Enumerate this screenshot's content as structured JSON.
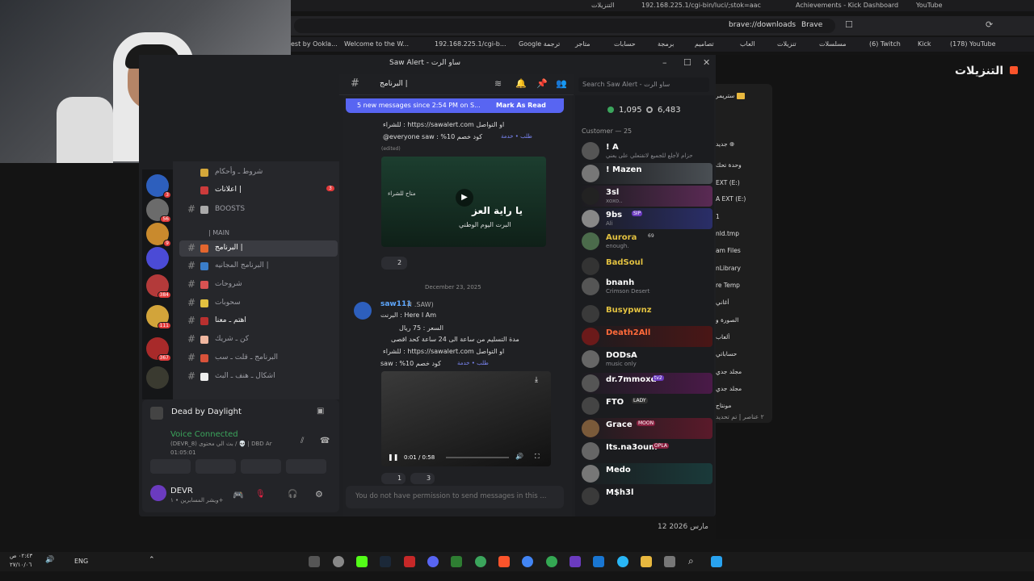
{
  "browser": {
    "tabs": [
      "التنزيلات",
      "192.168.225.1/cgi-bin/luci/;stok=aac",
      "Achievements - Kick Dashboard",
      "YouTube"
    ],
    "url": "brave://downloads",
    "brand": "Brave",
    "bookmarks": [
      "est by Ookla...",
      "Welcome to the W...",
      "192.168.225.1/cgi-b...",
      "Google ترجمة",
      "متاجر",
      "حسابات",
      "برمجة",
      "تصاميم",
      "العاب",
      "تنزيلات",
      "مسلسلات",
      "(6) Twitch",
      "Kick",
      "(178) YouTube"
    ],
    "page_title": "التنزيلات",
    "date": "12 مارس 2026"
  },
  "explorer": {
    "top": "ستريمر",
    "new": "جديد",
    "rows": [
      "وحدة تحك",
      "EXT (E:)",
      "A EXT (E:)",
      "1",
      "nld.tmp",
      "am Files",
      "nLibrary",
      "re Temp",
      "أغاني",
      "الصورة و",
      "ألعاب",
      "حساباتي",
      "مجلد جدي",
      "مجلد جدي",
      "مونتاج"
    ],
    "footer": "٢ عناصر | تم تحديد"
  },
  "discord": {
    "title": "Saw Alert - ساو الرت",
    "channel": "البرنامج |",
    "search_placeholder": "Search Saw Alert - ساو الرت",
    "channels": [
      {
        "name": "شروط ـ وأحكام",
        "active": false
      },
      {
        "name": "اعلانات |",
        "active": false
      },
      {
        "name": "BOOSTS",
        "active": false
      },
      {
        "name": "| MAIN",
        "active": false,
        "category": true
      },
      {
        "name": "البرنامج |",
        "active": true
      },
      {
        "name": "البرنامج المجانيه |",
        "active": false
      },
      {
        "name": "شروحات",
        "active": false
      },
      {
        "name": "سحوبات",
        "active": false
      },
      {
        "name": "اهتم ـ معنا",
        "active": false
      },
      {
        "name": "كن ـ شريك",
        "active": false
      },
      {
        "name": "البرنامج ـ قلت ـ سب",
        "active": false
      },
      {
        "name": "اشكال ـ هنف ـ البث",
        "active": false
      }
    ],
    "server_badges": [
      "3",
      "56",
      "9",
      "384",
      "111",
      "367"
    ],
    "activity": "Dead by Daylight",
    "voice": {
      "status": "Voice Connected",
      "detail": "(DEVR_8) بث الي محتوى / 💀 | DBD Ar",
      "time": "01:05:01"
    },
    "user": {
      "name": "DEVR",
      "status": "ويشر المسابرين • ١+"
    },
    "banner": {
      "text": "5 new messages since 2:54 PM on S...",
      "action": "Mark As Read"
    },
    "messages": {
      "top_lines": [
        "للشراء : https://sawalert.com او التواصل",
        "@everyone saw : %10 كود خصم"
      ],
      "top_tag": "طلب • خدمة",
      "edited": "(edited)",
      "reaction_top": "2",
      "date_divider": "December 23, 2025",
      "author": "saw111",
      "author_tag": "(! .SAW)",
      "lines": [
        "البرنت : Here I Am",
        "السعر : 75 ريال",
        "مدة التسليم من ساعة الى 24 ساعة كحد اقصى",
        "للشراء : https://sawalert.com او التواصل",
        "saw : %10 كود خصم"
      ],
      "tag": "طلب • خدمة",
      "image_text": [
        "يا راية العز",
        "البرت اليوم الوطني",
        "متاح للشراء"
      ],
      "video_time": "0:01 / 0:58",
      "reactions": [
        "1",
        "3"
      ],
      "no_permission": "You do not have permission to send messages in this ..."
    },
    "stats": {
      "online": "1,095",
      "members": "6,483"
    },
    "role": "Customer — 25",
    "members": [
      {
        "name": "! A",
        "status": "حزام لأجلع للجميع لاتفتعلي على يعني"
      },
      {
        "name": "! Mazen",
        "status": ""
      },
      {
        "name": "3sl",
        "status": "xoxo.."
      },
      {
        "name": "9bs",
        "status": "Ali"
      },
      {
        "name": "Aurora",
        "status": "enough."
      },
      {
        "name": "BadSoul",
        "status": ""
      },
      {
        "name": "bnanh",
        "status": "Crimson Desert"
      },
      {
        "name": "Busypwnz",
        "status": ""
      },
      {
        "name": "Death2All",
        "status": ""
      },
      {
        "name": "DODsA",
        "status": "music only"
      },
      {
        "name": "dr.7mmoxd",
        "status": ""
      },
      {
        "name": "FTO",
        "status": ""
      },
      {
        "name": "Grace",
        "status": ""
      },
      {
        "name": "Its.na3oum",
        "status": ""
      },
      {
        "name": "Medo",
        "status": ""
      },
      {
        "name": "M$h3l",
        "status": ""
      }
    ],
    "member_tags": [
      "SIP",
      "69",
      "tv2",
      "LADY",
      "MOON",
      "OPLA"
    ]
  },
  "taskbar": {
    "time": "٠٢:٤٣ ص",
    "date": "٢٧/١٠/٠٦",
    "lang": "ENG"
  }
}
